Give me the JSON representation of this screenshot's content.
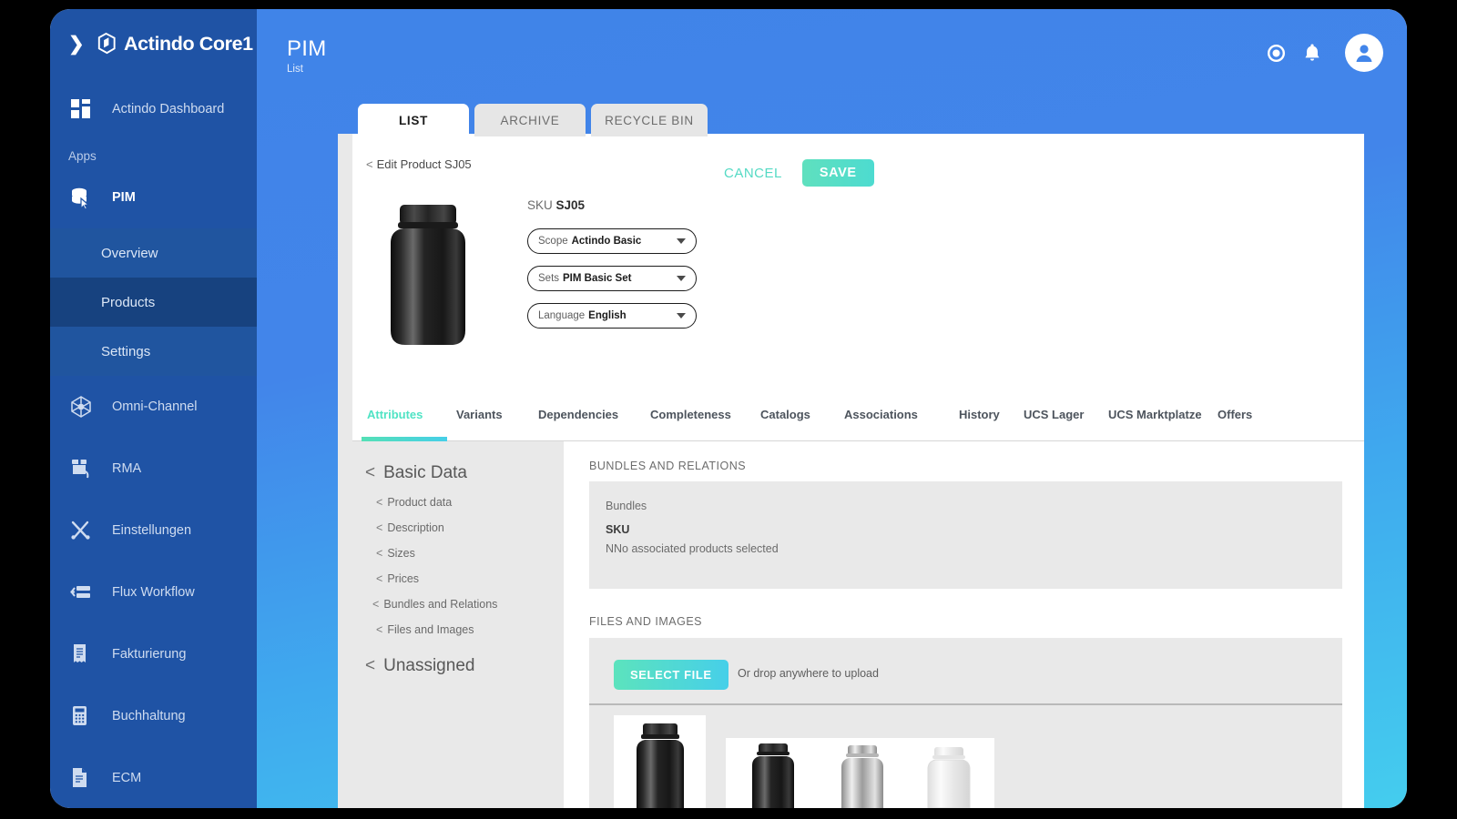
{
  "brand": {
    "name": "Actindo Core1",
    "logo_icon": "actindo-cube-icon",
    "collapse_icon": "chevron-right-icon"
  },
  "sidebar": {
    "dashboard": {
      "label": "Actindo Dashboard",
      "icon": "grid-dashboard-icon"
    },
    "section_label": "Apps",
    "app": {
      "label": "PIM",
      "icon": "database-cursor-icon"
    },
    "sub_items": [
      {
        "label": "Overview",
        "selected": false
      },
      {
        "label": "Products",
        "selected": true
      },
      {
        "label": "Settings",
        "selected": false
      }
    ],
    "items": [
      {
        "label": "Omni-Channel",
        "icon": "omni-channel-icon"
      },
      {
        "label": "RMA",
        "icon": "return-box-icon"
      },
      {
        "label": "Einstellungen",
        "icon": "tools-icon"
      },
      {
        "label": "Flux Workflow",
        "icon": "workflow-icon"
      },
      {
        "label": "Fakturierung",
        "icon": "invoice-icon"
      },
      {
        "label": "Buchhaltung",
        "icon": "calculator-icon"
      },
      {
        "label": "ECM",
        "icon": "document-icon"
      }
    ]
  },
  "header": {
    "title": "PIM",
    "subtitle": "List",
    "icons": [
      {
        "name": "record-circle-icon"
      },
      {
        "name": "bell-icon"
      }
    ],
    "avatar_icon": "user-avatar-icon"
  },
  "top_tabs": [
    {
      "label": "LIST",
      "active": true
    },
    {
      "label": "ARCHIVE",
      "active": false
    },
    {
      "label": "RECYCLE BIN",
      "active": false
    }
  ],
  "product": {
    "breadcrumb_chevron": "<",
    "breadcrumb": "Edit Product SJ05",
    "cancel_label": "CANCEL",
    "save_label": "SAVE",
    "sku_label": "SKU",
    "sku_value": "SJ05",
    "image_icon": "black-supplement-jar-image",
    "selects": [
      {
        "label": "Scope",
        "value": "Actindo Basic"
      },
      {
        "label": "Sets",
        "value": "PIM Basic Set"
      },
      {
        "label": "Language",
        "value": "English"
      }
    ]
  },
  "attribute_tabs": [
    {
      "label": "Attributes",
      "active": true
    },
    {
      "label": "Variants",
      "active": false
    },
    {
      "label": "Dependencies",
      "active": false
    },
    {
      "label": "Completeness",
      "active": false
    },
    {
      "label": "Catalogs",
      "active": false
    },
    {
      "label": "Associations",
      "active": false
    },
    {
      "label": "History",
      "active": false
    },
    {
      "label": "UCS Lager",
      "active": false
    },
    {
      "label": "UCS Marktplatze",
      "active": false
    },
    {
      "label": "Offers",
      "active": false
    }
  ],
  "sub_nav": {
    "groups": [
      {
        "label": "Basic Data",
        "items": [
          {
            "label": "Product data"
          },
          {
            "label": "Description"
          },
          {
            "label": "Sizes"
          },
          {
            "label": "Prices"
          },
          {
            "label": "Bundles and Relations"
          },
          {
            "label": "Files and Images"
          }
        ]
      },
      {
        "label": "Unassigned",
        "items": []
      }
    ]
  },
  "content": {
    "bundles_section_title": "BUNDLES AND RELATIONS",
    "bundles_label": "Bundles",
    "bundles_sku_header": "SKU",
    "bundles_empty_text": "NNo associated products selected",
    "files_section_title": "FILES AND IMAGES",
    "select_file_label": "SELECT FILE",
    "drop_hint": "Or drop anywhere to upload",
    "thumbnails": [
      {
        "name": "black-jar-thumbnail"
      },
      {
        "name": "three-jars-thumbnail"
      }
    ]
  },
  "colors": {
    "sidebar": "#1f53a5",
    "sidebar_selected": "#17427f",
    "header_blue": "#4285ea",
    "header_cyan": "#44cdee",
    "accent_teal": "#4fe3c4",
    "panel_grey": "#e9e9e9"
  }
}
